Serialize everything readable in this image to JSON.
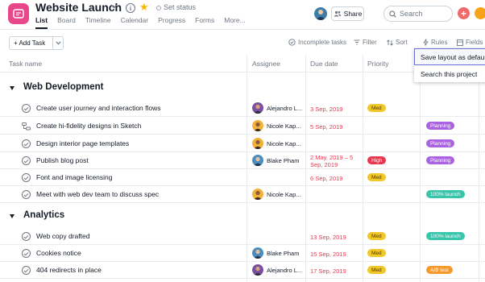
{
  "header": {
    "title": "Website Launch",
    "set_status": "Set status",
    "share_label": "Share",
    "search_placeholder": "Search",
    "add_symbol": "+",
    "tabs": [
      {
        "label": "List",
        "active": true
      },
      {
        "label": "Board",
        "active": false
      },
      {
        "label": "Timeline",
        "active": false
      },
      {
        "label": "Calendar",
        "active": false
      },
      {
        "label": "Progress",
        "active": false
      },
      {
        "label": "Forms",
        "active": false
      },
      {
        "label": "More...",
        "active": false
      }
    ]
  },
  "toolbar": {
    "add_task_label": "+ Add Task",
    "incomplete_tasks": "Incomplete tasks",
    "filter": "Filter",
    "sort": "Sort",
    "rules": "Rules",
    "fields": "Fields"
  },
  "columns": {
    "task_name": "Task name",
    "assignee": "Assignee",
    "due_date": "Due date",
    "priority": "Priority"
  },
  "dropdown": {
    "items": [
      "Save layout as default",
      "Search this project"
    ]
  },
  "colors": {
    "brand": "#e8488a",
    "due_red": "#e8384f",
    "priority_med": "#f2c72b",
    "priority_high": "#e8384f",
    "tag_planning": "#aa62e3",
    "tag_launch": "#37c5ab",
    "tag_abtest": "#f79a2e"
  },
  "sections": [
    {
      "title": "Web Development",
      "tasks": [
        {
          "name": "Create user journey and interaction flows",
          "icon": "check-circle-icon",
          "assignee": "Alejandro L...",
          "due": "3 Sep, 2019",
          "priority": "Med",
          "tag": ""
        },
        {
          "name": "Create hi-fidelity designs in Sketch",
          "icon": "subtask-icon",
          "assignee": "Nicole Kap...",
          "due": "5 Sep, 2019",
          "priority": "",
          "tag": "Planning"
        },
        {
          "name": "Design interior page templates",
          "icon": "check-circle-icon",
          "assignee": "Nicole Kap...",
          "due": "",
          "priority": "",
          "tag": "Planning"
        },
        {
          "name": "Publish blog post",
          "icon": "check-circle-icon",
          "assignee": "Blake Pham",
          "due": "2 May, 2019 – 5 Sep, 2019",
          "priority": "High",
          "tag": "Planning"
        },
        {
          "name": "Font and image licensing",
          "icon": "check-circle-icon",
          "assignee": "",
          "due": "6 Sep, 2019",
          "priority": "Med",
          "tag": ""
        },
        {
          "name": "Meet with web dev team to discuss spec",
          "icon": "check-circle-icon",
          "assignee": "Nicole Kap...",
          "due": "",
          "priority": "",
          "tag": "100% launch"
        }
      ]
    },
    {
      "title": "Analytics",
      "tasks": [
        {
          "name": "Web copy drafted",
          "icon": "check-circle-icon",
          "assignee": "",
          "due": "13 Sep, 2019",
          "priority": "Med",
          "tag": "100% launch"
        },
        {
          "name": "Cookies notice",
          "icon": "check-circle-icon",
          "assignee": "Blake Pham",
          "due": "15 Sep, 2019",
          "priority": "Med",
          "tag": ""
        },
        {
          "name": "404 redirects in place",
          "icon": "check-circle-icon",
          "assignee": "Alejandro L...",
          "due": "17 Sep, 2019",
          "priority": "Med",
          "tag": "A/B test"
        }
      ]
    }
  ]
}
